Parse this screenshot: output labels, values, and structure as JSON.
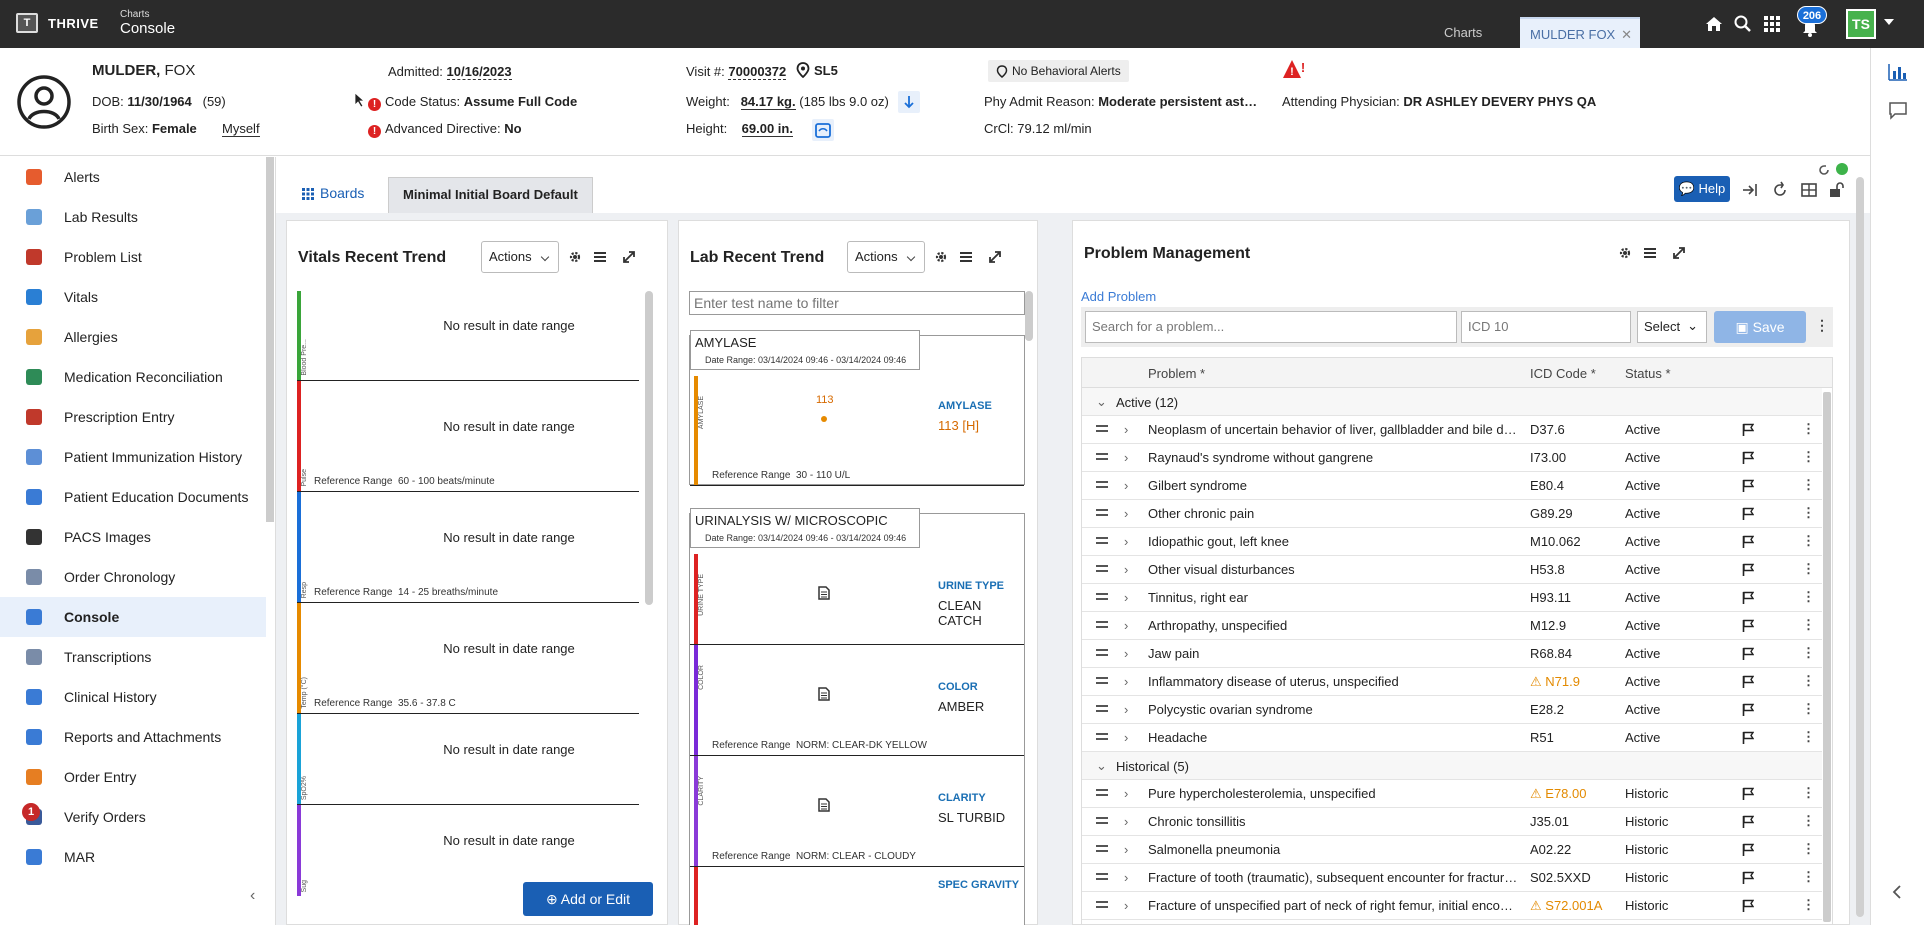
{
  "topbar": {
    "brand": "THRIVE",
    "crumb_sub": "Charts",
    "crumb_main": "Console",
    "tabs": [
      {
        "label": "Charts"
      },
      {
        "label": "MULDER FOX",
        "close": "✕"
      }
    ],
    "notification_count": "206",
    "user_initials": "TS"
  },
  "patient": {
    "last_name": "MULDER,",
    "first_name": "FOX",
    "dob_label": "DOB:",
    "dob": "11/30/1964",
    "age": "(59)",
    "birth_sex_label": "Birth Sex:",
    "birth_sex": "Female",
    "myself": "Myself",
    "admitted_label": "Admitted:",
    "admitted": "10/16/2023",
    "code_status_label": "Code Status:",
    "code_status": "Assume Full Code",
    "adv_directive_label": "Advanced Directive:",
    "adv_directive": "No",
    "visit_label": "Visit #:",
    "visit": "70000372",
    "location": "SL5",
    "weight_label": "Weight:",
    "weight": "84.17 kg.",
    "weight_lbs": "(185 lbs 9.0 oz)",
    "height_label": "Height:",
    "height": "69.00 in.",
    "behavioral_alerts": "No Behavioral Alerts",
    "phy_admit_label": "Phy Admit Reason:",
    "phy_admit": "Moderate persistent ast…",
    "crcl_label": "CrCl:",
    "crcl": "79.12 ml/min",
    "attending_label": "Attending Physician:",
    "attending": "DR ASHLEY DEVERY PHYS QA"
  },
  "sidebar": {
    "items": [
      {
        "label": "Alerts",
        "color": "#e65c2e"
      },
      {
        "label": "Lab Results",
        "color": "#6aa0d8"
      },
      {
        "label": "Problem List",
        "color": "#c0392b"
      },
      {
        "label": "Vitals",
        "color": "#2a7fd4"
      },
      {
        "label": "Allergies",
        "color": "#e6a23c"
      },
      {
        "label": "Medication Reconciliation",
        "color": "#2e8b57"
      },
      {
        "label": "Prescription Entry",
        "color": "#c0392b"
      },
      {
        "label": "Patient Immunization History",
        "color": "#5d8fd6"
      },
      {
        "label": "Patient Education Documents",
        "color": "#3a7bd5"
      },
      {
        "label": "PACS Images",
        "color": "#333333"
      },
      {
        "label": "Order Chronology",
        "color": "#7a8ca8"
      },
      {
        "label": "Console",
        "color": "#3a7bd5"
      },
      {
        "label": "Transcriptions",
        "color": "#7a8ca8"
      },
      {
        "label": "Clinical History",
        "color": "#3a7bd5"
      },
      {
        "label": "Reports and Attachments",
        "color": "#3a7bd5"
      },
      {
        "label": "Order Entry",
        "color": "#e67e22"
      },
      {
        "label": "Verify Orders",
        "color": "#3a5a9a"
      },
      {
        "label": "MAR",
        "color": "#3a7bd5"
      }
    ],
    "verify_badge": "1"
  },
  "board": {
    "boards_label": "Boards",
    "tab_label": "Minimal Initial Board Default",
    "help_label": "Help"
  },
  "vitals": {
    "title": "Vitals Recent Trend",
    "actions": "Actions",
    "rows": [
      {
        "name": "Blood Pre...",
        "color": "#3aa53a",
        "result": "No result in date range",
        "ref_label": "",
        "ref": ""
      },
      {
        "name": "Pulse",
        "color": "#d22",
        "result": "No result in date range",
        "ref_label": "Reference Range",
        "ref": "60 - 100 beats/minute"
      },
      {
        "name": "Resp",
        "color": "#1a6fd8",
        "result": "No result in date range",
        "ref_label": "Reference Range",
        "ref": "14 - 25 breaths/minute"
      },
      {
        "name": "Temp (°C)",
        "color": "#e68a00",
        "result": "No result in date range",
        "ref_label": "Reference Range",
        "ref": "35.6 - 37.8 C"
      },
      {
        "name": "SpO2%",
        "color": "#1aa3d8",
        "result": "No result in date range",
        "ref_label": "",
        "ref": ""
      },
      {
        "name": "Sug",
        "color": "#8a3ad8",
        "result": "No result in date range",
        "ref_label": "",
        "ref": ""
      }
    ],
    "add_edit": "Add or Edit"
  },
  "lab": {
    "title": "Lab Recent Trend",
    "actions": "Actions",
    "filter_placeholder": "Enter test name to filter",
    "groups": [
      {
        "title": "AMYLASE",
        "date_range": "Date Range: 03/14/2024 09:46 - 03/14/2024 09:46",
        "rows": [
          {
            "name": "AMYLASE",
            "color": "#e68a00",
            "point_label": "113",
            "test": "AMYLASE",
            "value": "113 [H]",
            "value_color": "#d66a00",
            "ref_label": "Reference Range",
            "ref": "30 - 110 U/L"
          }
        ]
      },
      {
        "title": "URINALYSIS W/ MICROSCOPIC",
        "date_range": "Date Range: 03/14/2024 09:46 - 03/14/2024 09:46",
        "rows": [
          {
            "name": "URINE TYPE",
            "color": "#d22",
            "test": "URINE TYPE",
            "value": "CLEAN CATCH",
            "ref_label": "",
            "ref": ""
          },
          {
            "name": "COLOR",
            "color": "#7a2ad8",
            "test": "COLOR",
            "value": "AMBER",
            "ref_label": "Reference Range",
            "ref": "NORM: CLEAR-DK YELLOW"
          },
          {
            "name": "CLARITY",
            "color": "#8a3ad8",
            "test": "CLARITY",
            "value": "SL TURBID",
            "ref_label": "Reference Range",
            "ref": "NORM: CLEAR - CLOUDY"
          },
          {
            "name": "",
            "color": "#d22",
            "test": "SPEC GRAVITY",
            "value": "",
            "ref_label": "",
            "ref": ""
          }
        ]
      }
    ]
  },
  "problems": {
    "title": "Problem Management",
    "add_problem": "Add Problem",
    "search_placeholder": "Search for a problem...",
    "icd_placeholder": "ICD 10",
    "select_label": "Select",
    "save_label": "Save",
    "columns": {
      "problem": "Problem *",
      "icd": "ICD Code *",
      "status": "Status *"
    },
    "active_group": "Active (12)",
    "historical_group": "Historical (5)",
    "active": [
      {
        "name": "Neoplasm of uncertain behavior of liver, gallbladder and bile ducts",
        "icd": "D37.6",
        "status": "Active",
        "warn": false
      },
      {
        "name": "Raynaud's syndrome without gangrene",
        "icd": "I73.00",
        "status": "Active",
        "warn": false
      },
      {
        "name": "Gilbert syndrome",
        "icd": "E80.4",
        "status": "Active",
        "warn": false
      },
      {
        "name": "Other chronic pain",
        "icd": "G89.29",
        "status": "Active",
        "warn": false
      },
      {
        "name": "Idiopathic gout, left knee",
        "icd": "M10.062",
        "status": "Active",
        "warn": false
      },
      {
        "name": "Other visual disturbances",
        "icd": "H53.8",
        "status": "Active",
        "warn": false
      },
      {
        "name": "Tinnitus, right ear",
        "icd": "H93.11",
        "status": "Active",
        "warn": false
      },
      {
        "name": "Arthropathy, unspecified",
        "icd": "M12.9",
        "status": "Active",
        "warn": false
      },
      {
        "name": "Jaw pain",
        "icd": "R68.84",
        "status": "Active",
        "warn": false
      },
      {
        "name": "Inflammatory disease of uterus, unspecified",
        "icd": "N71.9",
        "status": "Active",
        "warn": true
      },
      {
        "name": "Polycystic ovarian syndrome",
        "icd": "E28.2",
        "status": "Active",
        "warn": false
      },
      {
        "name": "Headache",
        "icd": "R51",
        "status": "Active",
        "warn": false
      }
    ],
    "historical": [
      {
        "name": "Pure hypercholesterolemia, unspecified",
        "icd": "E78.00",
        "status": "Historic",
        "warn": true
      },
      {
        "name": "Chronic tonsillitis",
        "icd": "J35.01",
        "status": "Historic",
        "warn": false
      },
      {
        "name": "Salmonella pneumonia",
        "icd": "A02.22",
        "status": "Historic",
        "warn": false
      },
      {
        "name": "Fracture of tooth (traumatic), subsequent encounter for fracture with routine healing",
        "icd": "S02.5XXD",
        "status": "Historic",
        "warn": false
      },
      {
        "name": "Fracture of unspecified part of neck of right femur, initial encounter",
        "icd": "S72.001A",
        "status": "Historic",
        "warn": true
      }
    ]
  }
}
